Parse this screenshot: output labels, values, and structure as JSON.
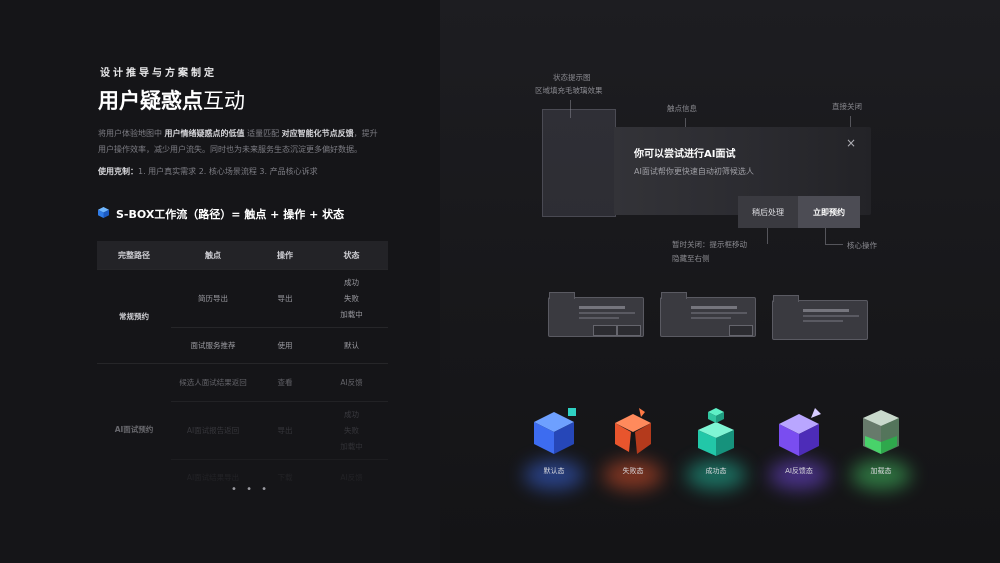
{
  "header": {
    "subtitle": "设计推导与方案制定",
    "title_bold": "用户疑惑点",
    "title_light": "互动"
  },
  "description": {
    "p1_a": "将用户体验地图中 ",
    "p1_b": "用户情绪疑惑点的低值",
    "p1_c": " 适量匹配 ",
    "p1_d": "对应智能化节点反馈",
    "p1_e": "，提升",
    "p2": "用户操作效率，减少用户流失。同时也为未来服务生态沉淀更多偏好数据。",
    "method_label": "使用克制：",
    "method_text": "1. 用户真实需求    2. 核心场景流程    3. 产品核心诉求"
  },
  "flow": {
    "title": "S-BOX工作流（路径）= 触点 + 操作 + 状态",
    "headers": [
      "完整路径",
      "触点",
      "操作",
      "状态"
    ],
    "groups": [
      {
        "name": "常规预约",
        "rows": [
          {
            "touch": "简历导出",
            "op": "导出",
            "status": [
              "成功",
              "失败",
              "加载中"
            ]
          },
          {
            "touch": "面试服务推荐",
            "op": "使用",
            "status": [
              "默认"
            ]
          }
        ]
      },
      {
        "name": "AI面试预约",
        "rows": [
          {
            "touch": "候选人面试结果返回",
            "op": "查看",
            "status": [
              "AI反馈"
            ]
          },
          {
            "touch": "AI面试报告返回",
            "op": "导出",
            "status": [
              "成功",
              "失败",
              "加载中"
            ]
          },
          {
            "touch": "AI面试结果导出",
            "op": "下载",
            "status": [
              "AI反馈"
            ]
          }
        ]
      }
    ],
    "pagination": "• • •"
  },
  "annotations": {
    "state_hint": "状态提示图",
    "state_hint_sub": "区域填充毛玻璃效果",
    "touch_info": "触点信息",
    "close_direct": "直接关闭",
    "temp_close": "暂时关闭：提示框移动",
    "temp_close_sub": "隐藏至右侧",
    "core_action": "核心操作"
  },
  "dialog": {
    "title": "你可以尝试进行AI面试",
    "text": "AI面试帮你更快速自动初筛候选人",
    "close_icon": "×",
    "btn_later": "稍后处理",
    "btn_book": "立即预约"
  },
  "states": [
    {
      "label": "默认态",
      "color": "#3d6cf0",
      "accent": "#2fd1c3"
    },
    {
      "label": "失败态",
      "color": "#e8552d",
      "accent": "#ff7a45"
    },
    {
      "label": "成功态",
      "color": "#22c7a8",
      "accent": "#5ef0c6"
    },
    {
      "label": "AI反馈态",
      "color": "#7a4df0",
      "accent": "#b9a6ff"
    },
    {
      "label": "加载态",
      "color": "#48d36a",
      "accent": "#c9f5d0"
    }
  ]
}
